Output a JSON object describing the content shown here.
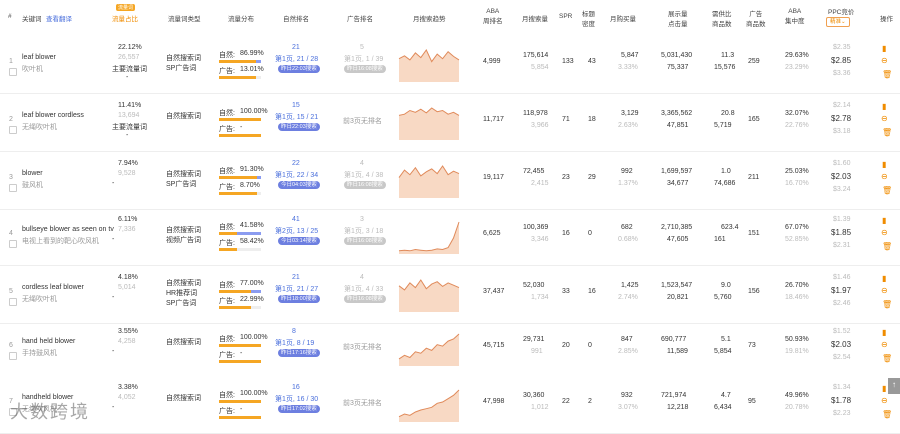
{
  "headers": {
    "index": "#",
    "keyword": "关键词",
    "translate": "查看翻译",
    "tag": "流量词",
    "traffic_share": "流量占比",
    "type": "流量词类型",
    "distribution": "流量分布",
    "organic_rank": "自然排名",
    "ad_rank": "广告排名",
    "trend": "月搜索趋势",
    "aba_rank": "ABA\n周排名",
    "monthly_search": "月搜索量",
    "spr": "SPR",
    "title_density": "标题\n密度",
    "monthly_buy": "月购买量",
    "impressions": "展示量\n点击量",
    "supply_demand": "需供比\n商品数",
    "ad_products": "广告\n商品数",
    "aba_conc": "ABA\n集中度",
    "ppc": "PPC竞价",
    "ppc_sort": "精准",
    "ops": "操作"
  },
  "rows": [
    {
      "idx": "1",
      "kw": "leaf blower",
      "cn": "吹叶机",
      "share": "22.12%",
      "share2": "26,557",
      "share3": "主要流量词",
      "share4": "-",
      "types": [
        "自然搜索词",
        "SP广告词"
      ],
      "org": "自然:",
      "org_pct": "86.99%",
      "ad": "广告:",
      "ad_pct": "13.01%",
      "org_frac": 0.87,
      "rank1": "21",
      "rank2": "第1页, 21 / 28",
      "rank_badge": "昨日22:03搜索",
      "adr1": "5",
      "adr2": "第1页, 1 / 39",
      "adr_badge": "昨日16:08搜索",
      "aba": "4,999",
      "ms1": "175,614",
      "ms2": "5,854",
      "spr": "133",
      "td": "43",
      "mb1": "5,847",
      "mb2": "3.33%",
      "im1": "5,031,430",
      "im2": "75,337",
      "sd1": "11.3",
      "sd2": "15,576",
      "adp": "259",
      "ac1": "29.63%",
      "ac2": "23.29%",
      "p1": "$2.35",
      "p2": "$2.85",
      "p3": "$3.36"
    },
    {
      "idx": "2",
      "kw": "leaf blower cordless",
      "cn": "无绳吹叶机",
      "share": "11.41%",
      "share2": "13,694",
      "share3": "主要流量词",
      "share4": "-",
      "types": [
        "自然搜索词"
      ],
      "org": "自然:",
      "org_pct": "100.00%",
      "ad": "广告:",
      "ad_pct": "-",
      "org_frac": 1.0,
      "rank1": "15",
      "rank2": "第1页, 15 / 21",
      "rank_badge": "昨日22:03搜索",
      "adr1": "",
      "adr2": "前3页无排名",
      "adr_badge": "",
      "aba": "11,717",
      "ms1": "118,978",
      "ms2": "3,966",
      "spr": "71",
      "td": "18",
      "mb1": "3,129",
      "mb2": "2.63%",
      "im1": "3,365,562",
      "im2": "47,851",
      "sd1": "20.8",
      "sd2": "5,719",
      "adp": "165",
      "ac1": "32.07%",
      "ac2": "22.76%",
      "p1": "$2.14",
      "p2": "$2.78",
      "p3": "$3.18"
    },
    {
      "idx": "3",
      "kw": "blower",
      "cn": "鼓风机",
      "share": "7.94%",
      "share2": "9,528",
      "share3": "-",
      "share4": "",
      "types": [
        "自然搜索词",
        "SP广告词"
      ],
      "org": "自然:",
      "org_pct": "91.30%",
      "ad": "广告:",
      "ad_pct": "8.70%",
      "org_frac": 0.91,
      "rank1": "22",
      "rank2": "第1页, 22 / 34",
      "rank_badge": "今日04:03搜索",
      "adr1": "4",
      "adr2": "第1页, 4 / 38",
      "adr_badge": "昨日16:08搜索",
      "aba": "19,117",
      "ms1": "72,455",
      "ms2": "2,415",
      "spr": "23",
      "td": "29",
      "mb1": "992",
      "mb2": "1.37%",
      "im1": "1,699,597",
      "im2": "34,677",
      "sd1": "1.0",
      "sd2": "74,686",
      "adp": "211",
      "ac1": "25.03%",
      "ac2": "16.70%",
      "p1": "$1.60",
      "p2": "$2.03",
      "p3": "$3.24"
    },
    {
      "idx": "4",
      "kw": "bullseye blower as seen on tv",
      "cn": "电视上看到的靶心吹风机",
      "share": "6.11%",
      "share2": "7,336",
      "share3": "-",
      "share4": "",
      "types": [
        "自然搜索词",
        "视频广告词"
      ],
      "org": "自然:",
      "org_pct": "41.58%",
      "ad": "广告:",
      "ad_pct": "58.42%",
      "org_frac": 0.42,
      "rank1": "41",
      "rank2": "第2页, 13 / 25",
      "rank_badge": "今日03:14搜索",
      "adr1": "3",
      "adr2": "第1页, 3 / 18",
      "adr_badge": "昨日16:08搜索",
      "aba": "6,625",
      "ms1": "100,369",
      "ms2": "3,346",
      "spr": "16",
      "td": "0",
      "mb1": "682",
      "mb2": "0.68%",
      "im1": "2,710,385",
      "im2": "47,605",
      "sd1": "623.4",
      "sd2": "161",
      "adp": "151",
      "ac1": "67.07%",
      "ac2": "52.85%",
      "p1": "$1.39",
      "p2": "$1.85",
      "p3": "$2.31"
    },
    {
      "idx": "5",
      "kw": "cordless leaf blower",
      "cn": "无绳吹叶机",
      "share": "4.18%",
      "share2": "5,014",
      "share3": "-",
      "share4": "",
      "types": [
        "自然搜索词",
        "HR推荐词",
        "SP广告词"
      ],
      "org": "自然:",
      "org_pct": "77.00%",
      "ad": "广告:",
      "ad_pct": "22.99%",
      "org_frac": 0.77,
      "rank1": "21",
      "rank2": "第1页, 21 / 27",
      "rank_badge": "昨日18:00搜索",
      "adr1": "4",
      "adr2": "第1页, 4 / 33",
      "adr_badge": "昨日16:08搜索",
      "aba": "37,437",
      "ms1": "52,030",
      "ms2": "1,734",
      "spr": "33",
      "td": "16",
      "mb1": "1,425",
      "mb2": "2.74%",
      "im1": "1,523,547",
      "im2": "20,821",
      "sd1": "9.0",
      "sd2": "5,760",
      "adp": "156",
      "ac1": "26.70%",
      "ac2": "18.46%",
      "p1": "$1.46",
      "p2": "$1.97",
      "p3": "$2.46"
    },
    {
      "idx": "6",
      "kw": "hand held blower",
      "cn": "手持鼓风机",
      "share": "3.55%",
      "share2": "4,258",
      "share3": "-",
      "share4": "",
      "types": [
        "自然搜索词"
      ],
      "org": "自然:",
      "org_pct": "100.00%",
      "ad": "广告:",
      "ad_pct": "-",
      "org_frac": 1.0,
      "rank1": "8",
      "rank2": "第1页, 8 / 19",
      "rank_badge": "昨日17:16搜索",
      "adr1": "",
      "adr2": "前3页无排名",
      "adr_badge": "",
      "aba": "45,715",
      "ms1": "29,731",
      "ms2": "991",
      "spr": "20",
      "td": "0",
      "mb1": "847",
      "mb2": "2.85%",
      "im1": "690,777",
      "im2": "11,589",
      "sd1": "5.1",
      "sd2": "5,854",
      "adp": "73",
      "ac1": "50.93%",
      "ac2": "19.81%",
      "p1": "$1.52",
      "p2": "$2.03",
      "p3": "$2.54"
    },
    {
      "idx": "7",
      "kw": "handheld blower",
      "cn": "无绳吹风机",
      "share": "3.38%",
      "share2": "4,052",
      "share3": "-",
      "share4": "",
      "types": [
        "自然搜索词"
      ],
      "org": "自然:",
      "org_pct": "100.00%",
      "ad": "广告:",
      "ad_pct": "-",
      "org_frac": 1.0,
      "rank1": "16",
      "rank2": "第1页, 16 / 30",
      "rank_badge": "昨日17:02搜索",
      "adr1": "",
      "adr2": "前3页无排名",
      "adr_badge": "",
      "aba": "47,998",
      "ms1": "30,360",
      "ms2": "1,012",
      "spr": "22",
      "td": "2",
      "mb1": "932",
      "mb2": "3.07%",
      "im1": "721,974",
      "im2": "12,218",
      "sd1": "4.7",
      "sd2": "6,434",
      "adp": "95",
      "ac1": "49.96%",
      "ac2": "20.78%",
      "p1": "$1.34",
      "p2": "$1.78",
      "p3": "$2.23"
    }
  ],
  "trends": [
    [
      40,
      45,
      38,
      50,
      42,
      55,
      35,
      48,
      40,
      52,
      44,
      38
    ],
    [
      40,
      42,
      48,
      45,
      50,
      44,
      52,
      46,
      48,
      42,
      45,
      40
    ],
    [
      35,
      48,
      40,
      52,
      38,
      45,
      50,
      42,
      55,
      40,
      46,
      42
    ],
    [
      5,
      6,
      5,
      7,
      6,
      5,
      6,
      8,
      7,
      10,
      25,
      50
    ],
    [
      45,
      38,
      50,
      42,
      55,
      40,
      48,
      52,
      44,
      50,
      46,
      42
    ],
    [
      10,
      15,
      12,
      20,
      18,
      25,
      22,
      30,
      28,
      35,
      38,
      45
    ],
    [
      8,
      12,
      10,
      15,
      18,
      20,
      22,
      28,
      30,
      35,
      40,
      48
    ]
  ],
  "colors": {
    "accent": "#f08c00",
    "blue": "#4a6fdc",
    "bar_org": "#f5a623",
    "bar_ad": "#8b9cf0",
    "trend_fill": "#f8d9c4",
    "trend_line": "#e08a5a"
  },
  "watermark": "大数跨境",
  "scroll_up": "↑"
}
